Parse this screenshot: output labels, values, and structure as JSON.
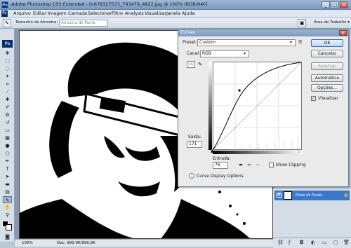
{
  "titlebar": {
    "title": "Adobe Photoshop CS3 Extended - [n678327573_793479_4822.jpg @ 100% (RGB/8#)]",
    "min": "_",
    "max": "□",
    "close": "×"
  },
  "menu": {
    "items": [
      "Arquivo",
      "Editar",
      "Imagem",
      "Camada",
      "Selecionar",
      "Filtro",
      "Analysis",
      "Visualizar",
      "Janela",
      "Ajuda"
    ]
  },
  "options": {
    "sample_label": "Tamanho da Amostra:",
    "sample_value": "Amostra de Ponto",
    "workspace_label": "Área de Trabalho ▾"
  },
  "statusbar": {
    "zoom": "100%",
    "doc": "Doc: 990,9K/990,9K"
  },
  "layers": {
    "layer_name": "Plano de Fundo"
  },
  "curves": {
    "title": "Curvas",
    "preset_label": "Preset:",
    "preset_value": "Custom",
    "channel_label": "Canal:",
    "channel_value": "RGB",
    "output_label": "Saída:",
    "output_value": "171",
    "input_label": "Entrada:",
    "input_value": "76",
    "show_clipping": "Show Clipping",
    "display_options": "Curve Display Options",
    "buttons": {
      "ok": "OK",
      "cancel": "Cancelar",
      "smooth": "Suavizar",
      "auto": "Automático",
      "options": "Opções...",
      "preview": "Visualizar"
    },
    "preview_checked": true,
    "show_clipping_checked": false
  },
  "colors": {
    "chrome_blue": "#7d9ac0",
    "ok_border": "#3a6fb4",
    "selected_layer": "#3b78c8"
  }
}
